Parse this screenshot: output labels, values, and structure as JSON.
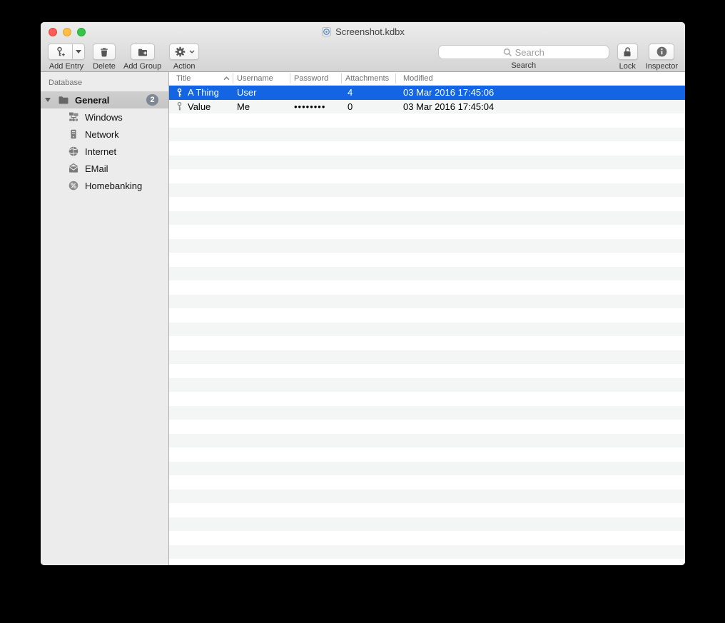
{
  "window": {
    "title": "Screenshot.kdbx"
  },
  "toolbar": {
    "add_entry_label": "Add Entry",
    "delete_label": "Delete",
    "add_group_label": "Add Group",
    "action_label": "Action",
    "search_placeholder": "Search",
    "search_item_label": "Search",
    "lock_label": "Lock",
    "inspector_label": "Inspector"
  },
  "sidebar": {
    "header": "Database",
    "groups": [
      {
        "label": "General",
        "icon": "folder-icon",
        "level": 0,
        "expanded": true,
        "selected": true,
        "badge": "2"
      },
      {
        "label": "Windows",
        "icon": "windows-network-icon",
        "level": 1
      },
      {
        "label": "Network",
        "icon": "server-icon",
        "level": 1
      },
      {
        "label": "Internet",
        "icon": "globe-icon",
        "level": 1
      },
      {
        "label": "EMail",
        "icon": "envelope-icon",
        "level": 1
      },
      {
        "label": "Homebanking",
        "icon": "percent-icon",
        "level": 1
      }
    ]
  },
  "table": {
    "columns": [
      {
        "label": "Title",
        "sort": "asc"
      },
      {
        "label": "Username"
      },
      {
        "label": "Password"
      },
      {
        "label": "Attachments"
      },
      {
        "label": "Modified"
      }
    ],
    "rows": [
      {
        "icon": "key-icon",
        "title": "A Thing",
        "username": "User",
        "password": "",
        "attachments": "4",
        "modified": "03 Mar 2016 17:45:06",
        "selected": true
      },
      {
        "icon": "key-icon",
        "title": "Value",
        "username": "Me",
        "password": "••••••••",
        "attachments": "0",
        "modified": "03 Mar 2016 17:45:04",
        "selected": false
      }
    ]
  },
  "colors": {
    "selection_blue": "#1365e4",
    "row_stripe": "#f4f5f5",
    "sidebar_bg": "#ececec",
    "sidebar_selected": "#c9c9c9",
    "badge_bg": "#7e8792",
    "toolbar_top": "#ededed",
    "toolbar_bottom": "#d4d4d4",
    "traffic_red": "#fc5b57",
    "traffic_yellow": "#fdbe41",
    "traffic_green": "#35c649"
  }
}
